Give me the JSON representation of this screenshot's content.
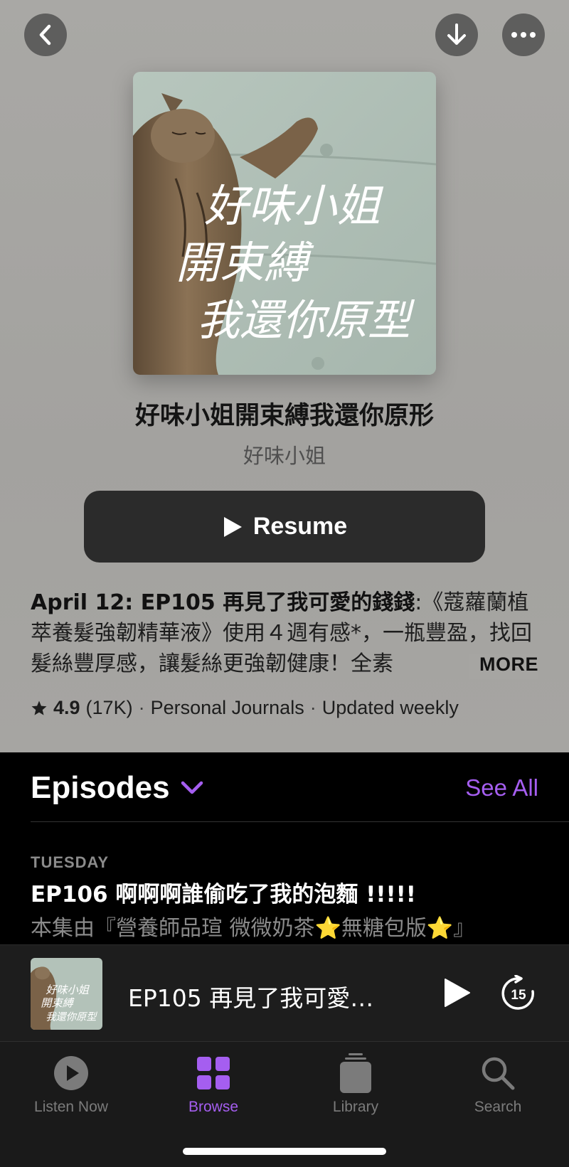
{
  "show": {
    "title": "好味小姐開束縛我還你原形",
    "author": "好味小姐",
    "cover_text_line1": "好味小姐",
    "cover_text_line2": "開束縛",
    "cover_text_line3": "我還你原型",
    "resume_label": "Resume",
    "description_bold": "April 12: EP105 再見了我可愛的錢錢",
    "description_rest": ":《蔻蘿蘭植萃養髮強韌精華液》使用４週有感*，一瓶豐盈，找回髮絲豐厚感，讓髮絲更強韌健康！全素",
    "more_label": "MORE",
    "rating": "4.9",
    "rating_count": "(17K)",
    "category": "Personal Journals",
    "frequency": "Updated weekly",
    "separator": "·"
  },
  "episodes": {
    "heading": "Episodes",
    "see_all_label": "See All",
    "items": [
      {
        "day": "TUESDAY",
        "title": "EP106 啊啊啊誰偷吃了我的泡麵 !!!!!",
        "description": "本集由『營養師品瑄 微微奶茶⭐無糖包版⭐』"
      }
    ]
  },
  "mini_player": {
    "title": "EP105 再見了我可愛…",
    "skip_seconds": "15"
  },
  "tabs": [
    {
      "label": "Listen Now",
      "icon": "play-circle-icon",
      "active": false
    },
    {
      "label": "Browse",
      "icon": "grid-icon",
      "active": true
    },
    {
      "label": "Library",
      "icon": "stack-icon",
      "active": false
    },
    {
      "label": "Search",
      "icon": "search-icon",
      "active": false
    }
  ],
  "colors": {
    "accent": "#a55ef0",
    "header_bg": "#a6a5a2",
    "button_bg": "#2b2b2b"
  }
}
